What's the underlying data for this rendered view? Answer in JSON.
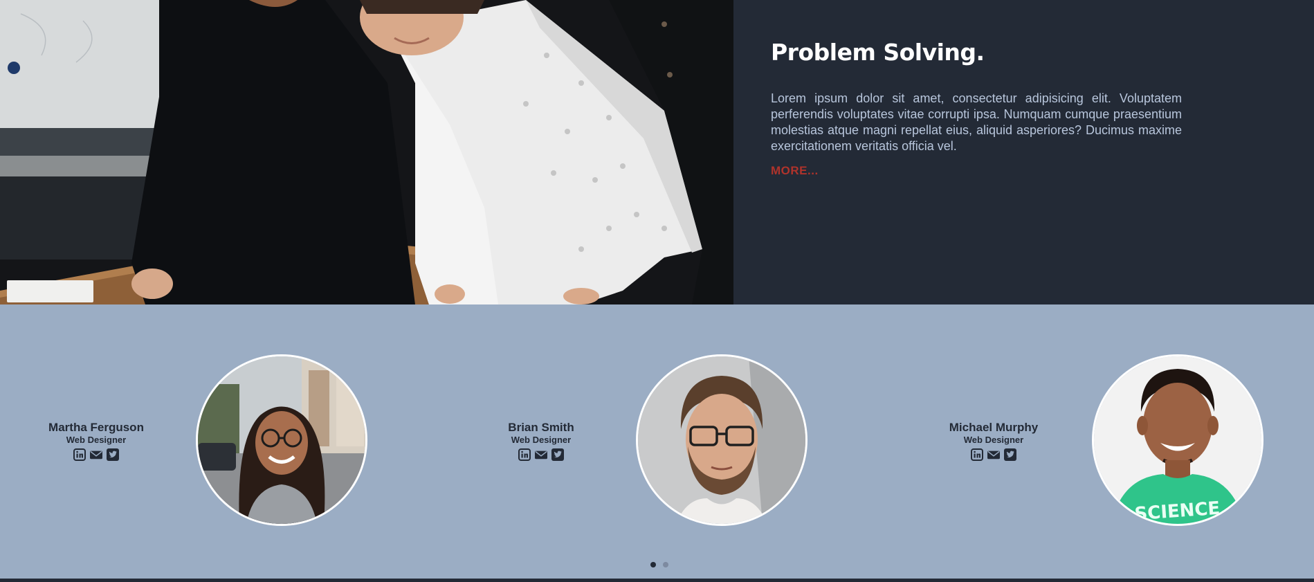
{
  "feature": {
    "title": "Problem Solving.",
    "body": "Lorem ipsum dolor sit amet, consectetur adipisicing elit. Voluptatem perferendis voluptates vitae corrupti ipsa. Numquam cumque praesentium molestias atque magni repellat eius, aliquid asperiores? Ducimus maxime exercitationem veritatis officia vel.",
    "more_label": "MORE..."
  },
  "team": {
    "members": [
      {
        "name": "Martha Ferguson",
        "role": "Web Designer"
      },
      {
        "name": "Brian Smith",
        "role": "Web Designer"
      },
      {
        "name": "Michael Murphy",
        "role": "Web Designer"
      }
    ],
    "social_icons": [
      "linkedin-icon",
      "envelope-icon",
      "twitter-icon"
    ],
    "carousel": {
      "pages": 2,
      "active": 1
    }
  },
  "colors": {
    "dark": "#232a36",
    "team_bg": "#9badc4",
    "accent": "#b0332b",
    "body_text": "#b8c6dc"
  }
}
